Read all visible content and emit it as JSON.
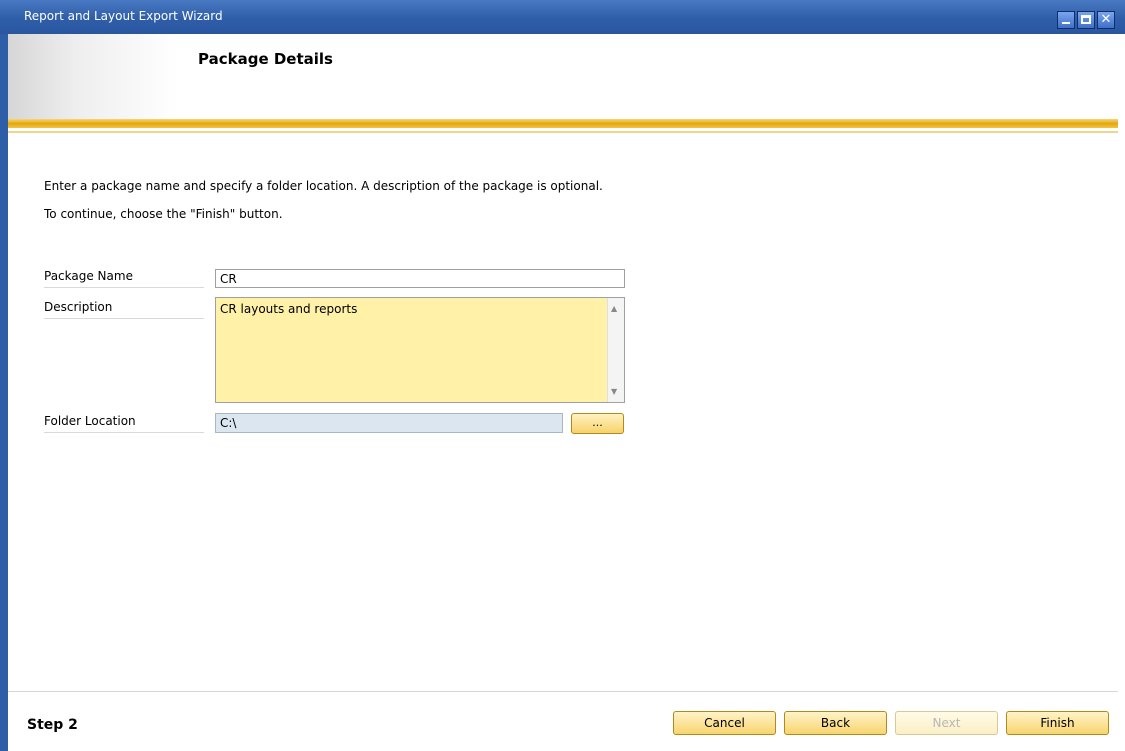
{
  "window": {
    "title": "Report and Layout Export Wizard"
  },
  "header": {
    "title": "Package Details"
  },
  "instructions": {
    "line1": "Enter a package name and specify a folder location. A description of the package is optional.",
    "line2": "To continue, choose the \"Finish\" button."
  },
  "form": {
    "package_name": {
      "label": "Package Name",
      "value": "CR"
    },
    "description": {
      "label": "Description",
      "value": "CR layouts and reports"
    },
    "folder_location": {
      "label": "Folder Location",
      "value": "C:\\",
      "browse_label": "..."
    }
  },
  "footer": {
    "step": "Step 2",
    "buttons": {
      "cancel": "Cancel",
      "back": "Back",
      "next": "Next",
      "finish": "Finish"
    },
    "next_enabled": false
  },
  "colors": {
    "titlebar": "#2f5ea8",
    "accent_gold": "#e3a70e",
    "description_bg": "#fff1a8",
    "folder_bg": "#dce6f1"
  }
}
